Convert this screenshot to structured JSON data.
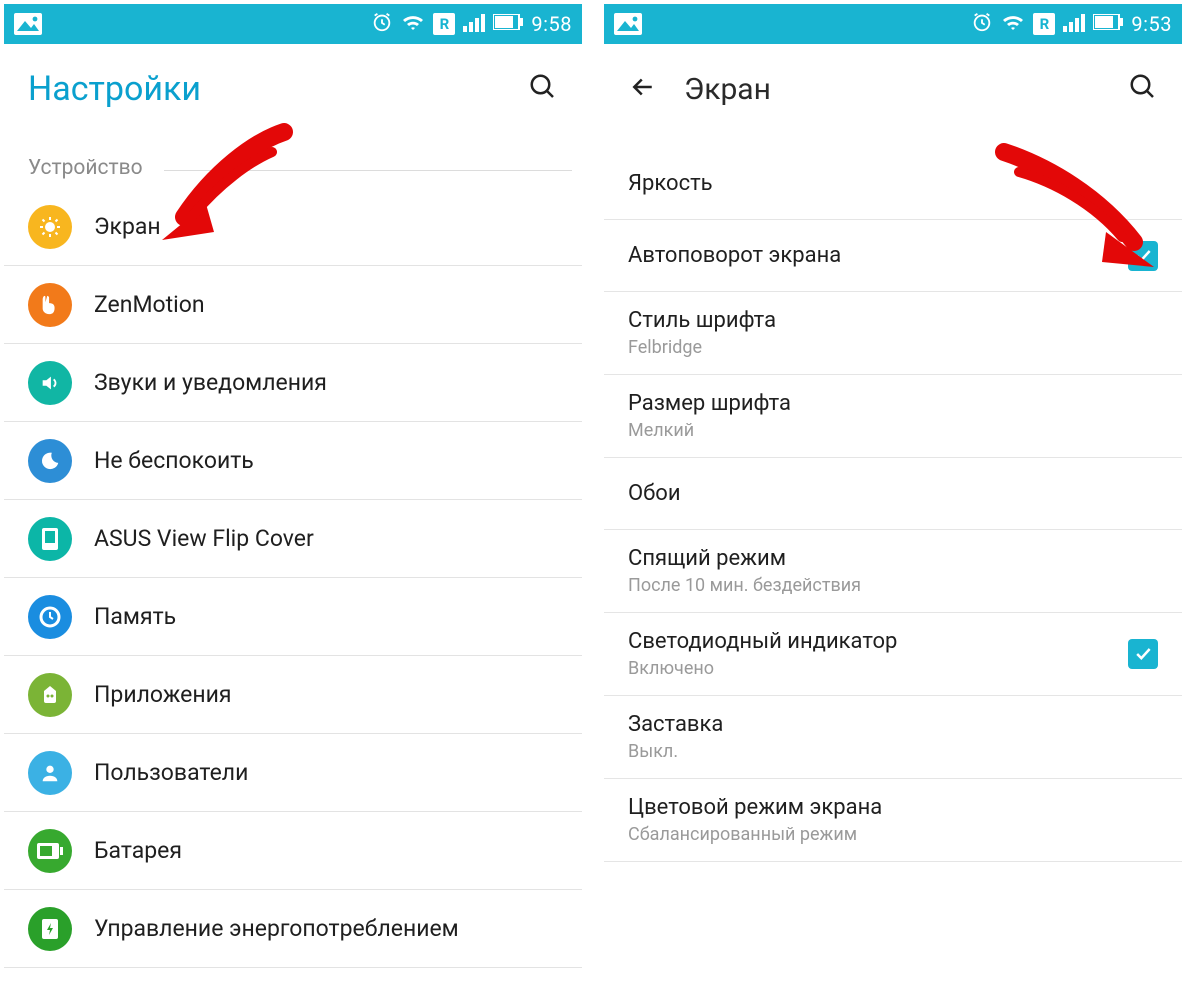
{
  "left": {
    "status_time": "9:58",
    "header_title": "Настройки",
    "section": "Устройство",
    "items": [
      {
        "label": "Экран",
        "icon": "display-icon"
      },
      {
        "label": "ZenMotion",
        "icon": "pointer-icon"
      },
      {
        "label": "Звуки и уведомления",
        "icon": "speaker-icon"
      },
      {
        "label": "Не беспокоить",
        "icon": "moon-icon"
      },
      {
        "label": "ASUS View Flip Cover",
        "icon": "flip-icon"
      },
      {
        "label": "Память",
        "icon": "clock-icon"
      },
      {
        "label": "Приложения",
        "icon": "apps-icon"
      },
      {
        "label": "Пользователи",
        "icon": "user-icon"
      },
      {
        "label": "Батарея",
        "icon": "battery-icon"
      },
      {
        "label": "Управление энергопотреблением",
        "icon": "power-icon"
      }
    ]
  },
  "right": {
    "status_time": "9:53",
    "header_title": "Экран",
    "items": [
      {
        "title": "Яркость"
      },
      {
        "title": "Автоповорот экрана",
        "check": true
      },
      {
        "title": "Стиль шрифта",
        "sub": "Felbridge"
      },
      {
        "title": "Размер шрифта",
        "sub": "Мелкий"
      },
      {
        "title": "Обои"
      },
      {
        "title": "Спящий режим",
        "sub": "После 10 мин. бездействия"
      },
      {
        "title": "Светодиодный индикатор",
        "sub": "Включено",
        "check": true
      },
      {
        "title": "Заставка",
        "sub": "Выкл."
      },
      {
        "title": "Цветовой режим экрана",
        "sub": "Сбалансированный режим"
      }
    ]
  },
  "r_badge": "R"
}
